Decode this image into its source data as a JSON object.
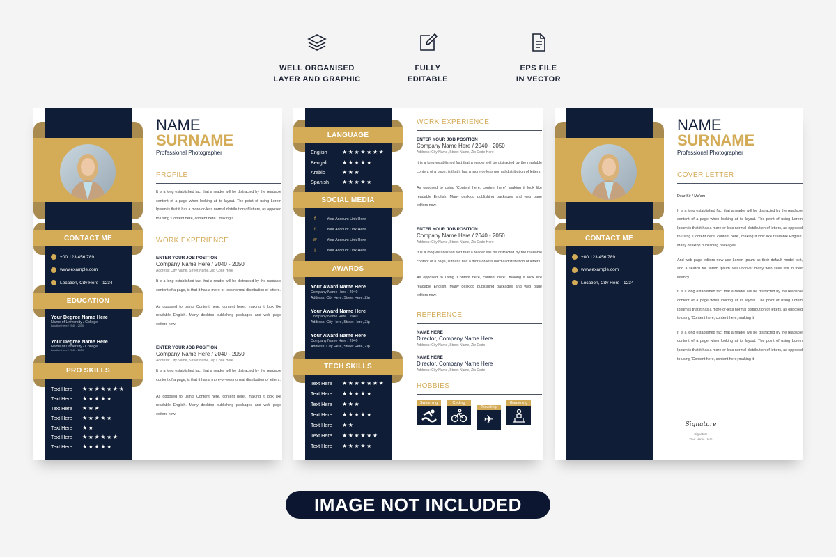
{
  "features": [
    {
      "icon": "layers-icon",
      "line1": "WELL ORGANISED",
      "line2": "LAYER AND GRAPHIC"
    },
    {
      "icon": "edit-icon",
      "line1": "FULLY",
      "line2": "EDITABLE"
    },
    {
      "icon": "file-icon",
      "line1": "EPS FILE",
      "line2": "IN VECTOR"
    }
  ],
  "colors": {
    "navy": "#0f1e36",
    "gold": "#d4ab57",
    "gold_dark": "#a98b50"
  },
  "resume": {
    "name": "NAME",
    "surname": "SURNAME",
    "title": "Professional Photographer",
    "contact_heading": "CONTACT ME",
    "contact": [
      {
        "icon": "phone-icon",
        "text": "+00 123 456 789"
      },
      {
        "icon": "globe-icon",
        "text": "www.example.com"
      },
      {
        "icon": "location-icon",
        "text": "Location, City Here - 1234"
      }
    ],
    "education_heading": "EDUCATION",
    "education": [
      {
        "degree": "Your Degree Name Here",
        "school": "Name of University / College",
        "meta": "Location Here / 2040 - 2050"
      },
      {
        "degree": "Your Degree Name Here",
        "school": "Name of University / College",
        "meta": "Location Here / 2040 - 2050"
      }
    ],
    "pro_skills_heading": "PRO SKILLS",
    "pro_skills": [
      {
        "name": "Text Here",
        "rating": 7
      },
      {
        "name": "Text Here",
        "rating": 5
      },
      {
        "name": "Text Here",
        "rating": 3
      },
      {
        "name": "Text Here",
        "rating": 5
      },
      {
        "name": "Text Here",
        "rating": 2
      },
      {
        "name": "Text Here",
        "rating": 6
      },
      {
        "name": "Text Here",
        "rating": 5
      }
    ],
    "profile_heading": "PROFILE",
    "profile": "It is a long established fact that a reader will be distracted by the readable content of a page when looking at its layout. The point of using Lorem Ipsum is that it has a more-or-less normal distribution of letters, as opposed to using 'Content here, content here', making it",
    "work_heading": "WORK EXPERIENCE",
    "jobs": [
      {
        "position": "ENTER YOUR JOB POSITION",
        "company": "Company Name Here / 2040 - 2050",
        "address": "Address: City Name, Street Name, Zip Code Here",
        "p1": "It is a long established fact that a reader will be distracted by the readable content of a page, is that it has a more-or-less normal distribution of letters.",
        "p2": "As opposed to using 'Content here, content here', making it look like readable English. Many desktop publishing packages and web page editors now."
      },
      {
        "position": "ENTER YOUR JOB POSITION",
        "company": "Company Name Here / 2040 - 2050",
        "address": "Address: City Name, Street Name, Zip Code Here",
        "p1": "It is a long established fact that a reader will be distracted by the readable content of a page, is that it has a more-or-less normal distribution of letters.",
        "p2": "As opposed to using 'Content here, content here', making it look like readable English. Many desktop publishing packages and web page editors now."
      }
    ]
  },
  "page2": {
    "language_heading": "LANGUAGE",
    "languages": [
      {
        "name": "English",
        "rating": 7
      },
      {
        "name": "Bengali",
        "rating": 5
      },
      {
        "name": "Arabic",
        "rating": 3
      },
      {
        "name": "Spanish",
        "rating": 5
      }
    ],
    "social_heading": "SOCIAL MEDIA",
    "social": [
      {
        "glyph": "f",
        "icon": "facebook-icon",
        "text": "Your Account Link Here"
      },
      {
        "glyph": "t",
        "icon": "twitter-icon",
        "text": "Your Account Link Here"
      },
      {
        "glyph": "w",
        "icon": "web-icon",
        "text": "Your Account Link Here"
      },
      {
        "glyph": "i",
        "icon": "linkedin-icon",
        "text": "Your Account Link Here"
      }
    ],
    "awards_heading": "AWARDS",
    "awards": [
      {
        "name": "Your Award Name Here",
        "company": "Company Name Here / 2040",
        "address": "Address: City Here, Street Here, Zip"
      },
      {
        "name": "Your Award Name Here",
        "company": "Company Name Here / 2040",
        "address": "Address: City Here, Street Here, Zip"
      },
      {
        "name": "Your Award Name Here",
        "company": "Company Name Here / 2040",
        "address": "Address: City Here, Street Here, Zip"
      }
    ],
    "tech_heading": "TECH SKILLS",
    "tech_skills": [
      {
        "name": "Text Here",
        "rating": 7
      },
      {
        "name": "Text Here",
        "rating": 5
      },
      {
        "name": "Text Here",
        "rating": 3
      },
      {
        "name": "Text Here",
        "rating": 5
      },
      {
        "name": "Text Here",
        "rating": 2
      },
      {
        "name": "Text Here",
        "rating": 6
      },
      {
        "name": "Text Here",
        "rating": 5
      }
    ],
    "reference_heading": "REFERENCE",
    "references": [
      {
        "name": "NAME HERE",
        "role": "Director, Company Name Here",
        "address": "Address: City Name, Street Name, Zip Code"
      },
      {
        "name": "NAME HERE",
        "role": "Director, Company Name Here",
        "address": "Address: City Name, Street Name, Zip Code"
      }
    ],
    "hobbies_heading": "HOBBIES",
    "hobbies": [
      {
        "label": "Swimming",
        "icon": "swimming-icon"
      },
      {
        "label": "Cycling",
        "icon": "cycling-icon"
      },
      {
        "label": "Traveling",
        "icon": "airplane-icon"
      },
      {
        "label": "Gardening",
        "icon": "gardening-icon"
      }
    ]
  },
  "cover": {
    "heading": "COVER LETTER",
    "greeting": "Dear Sir / Ma'am",
    "paragraphs": [
      "It is a long established fact that a reader will be distracted by the readable content of a page when looking at its layout. The point of using Lorem Ipsum is that it has a more-or-less normal distribution of letters, as opposed to using 'Content here, content here', making it look like readable English. Many desktop publishing packages.",
      "And web page editors now use Lorem Ipsum as their default model text, and a search for 'lorem ipsum' will uncover many web sites still in their infancy.",
      "It is a long established fact that a reader will be distracted by the readable content of a page when looking at its layout. The point of using Lorem Ipsum is that it has a more-or-less normal distribution of letters, as opposed to using 'Content here, content here; making it",
      "It is a long established fact that a reader will be distracted by the readable content of a page when looking at its layout. The point of using Lorem Ipsum is that it has a more-or-less normal distribution of letters, as opposed to using 'Content here, content here; making it"
    ],
    "signature_script": "Signature",
    "signature_label": "Signature",
    "signature_name": "Your Name Here"
  },
  "banner": "IMAGE NOT INCLUDED"
}
